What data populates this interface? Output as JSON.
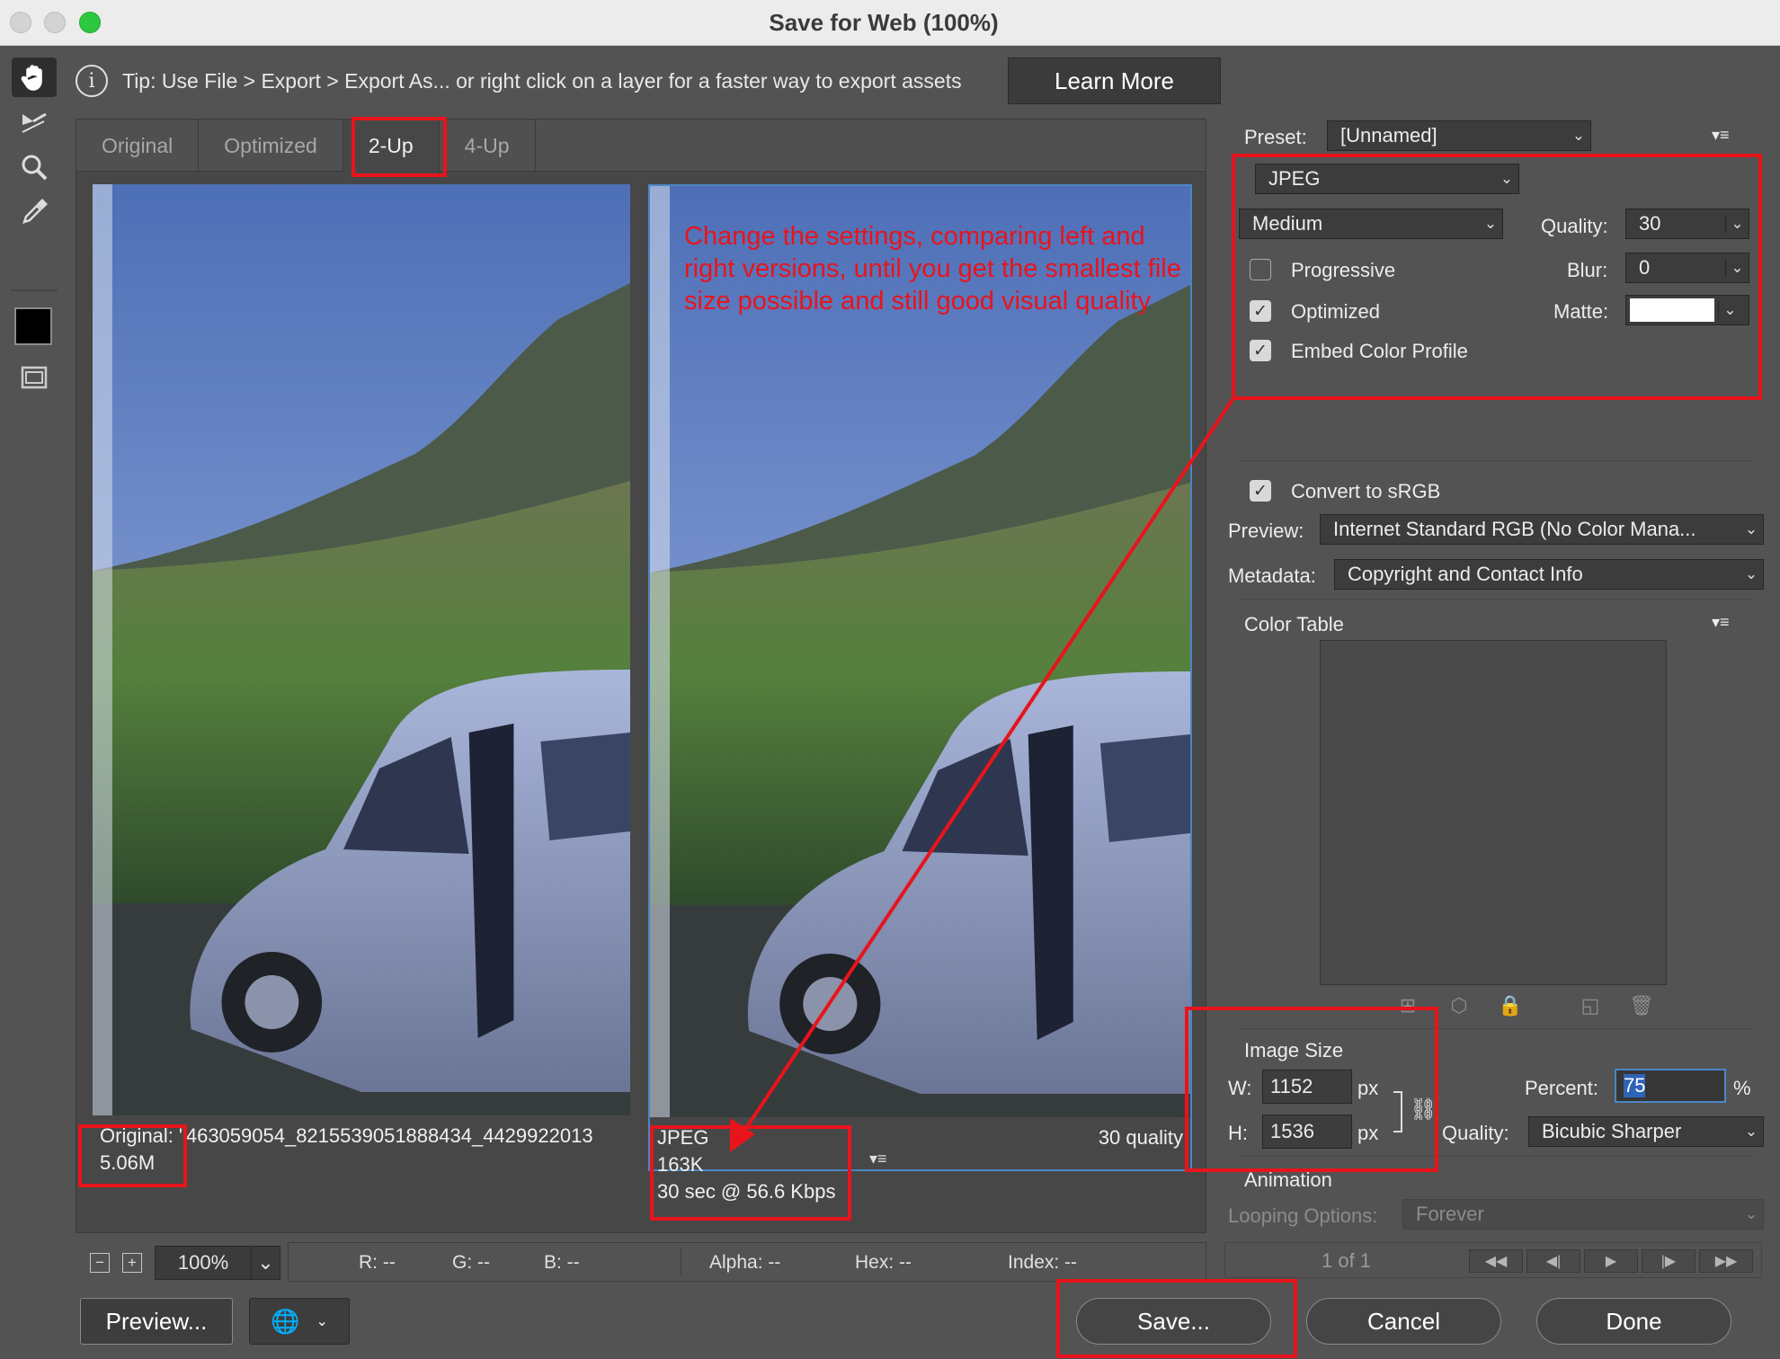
{
  "window": {
    "title": "Save for Web (100%)"
  },
  "toolbar": {
    "tools": [
      "hand-tool-icon",
      "slice-select-tool-icon",
      "zoom-tool-icon",
      "eyedropper-tool-icon"
    ],
    "swatch_color": "#000000"
  },
  "tip": {
    "text": "Tip: Use File > Export > Export As...  or right click on a layer for a faster way to export assets",
    "learn_more": "Learn More"
  },
  "tabs": [
    "Original",
    "Optimized",
    "2-Up",
    "4-Up"
  ],
  "active_tab": "2-Up",
  "left_pane": {
    "line1": "Original: \"463059054_8215539051888434_4429922013",
    "line2": "5.06M"
  },
  "right_pane": {
    "format": "JPEG",
    "size": "163K",
    "time": "30 sec @ 56.6 Kbps",
    "quality": "30 quality"
  },
  "annotation_note": "Change the settings, comparing left and right versions, until you get the smallest file size possible and still good visual quality",
  "bottom_bar": {
    "zoom": "100%",
    "r": "R: --",
    "g": "G: --",
    "b": "B: --",
    "alpha": "Alpha: --",
    "hex": "Hex: --",
    "index": "Index: --"
  },
  "buttons": {
    "preview": "Preview...",
    "save": "Save...",
    "cancel": "Cancel",
    "done": "Done"
  },
  "settings": {
    "preset_label": "Preset:",
    "preset": "[Unnamed]",
    "format": "JPEG",
    "compression": "Medium",
    "quality_label": "Quality:",
    "quality": "30",
    "progressive": "Progressive",
    "progressive_checked": false,
    "blur_label": "Blur:",
    "blur": "0",
    "optimized": "Optimized",
    "optimized_checked": true,
    "matte_label": "Matte:",
    "matte_color": "#ffffff",
    "embed_profile": "Embed Color Profile",
    "embed_checked": true,
    "convert_srgb": "Convert to sRGB",
    "convert_checked": true,
    "preview_label": "Preview:",
    "preview": "Internet Standard RGB (No Color Mana...",
    "metadata_label": "Metadata:",
    "metadata": "Copyright and Contact Info",
    "color_table": "Color Table"
  },
  "image_size": {
    "title": "Image Size",
    "w_label": "W:",
    "w": "1152",
    "h_label": "H:",
    "h": "1536",
    "unit": "px",
    "percent_label": "Percent:",
    "percent": "75",
    "percent_unit": "%",
    "quality_label": "Quality:",
    "quality": "Bicubic Sharper"
  },
  "animation": {
    "title": "Animation",
    "looping_label": "Looping Options:",
    "looping": "Forever",
    "frame": "1 of 1"
  },
  "colors": {
    "annotation_red": "#e8141c",
    "selection_blue": "#4b86c4",
    "panel_bg": "#535353"
  }
}
